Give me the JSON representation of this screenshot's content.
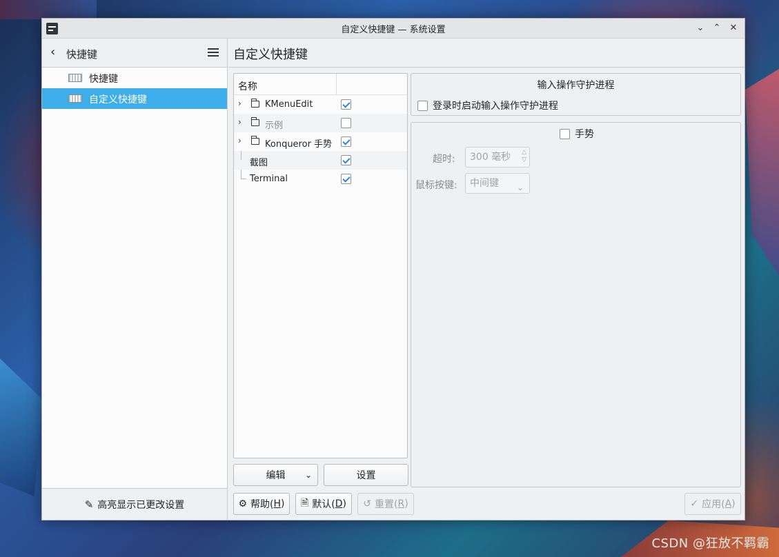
{
  "window": {
    "title": "自定义快捷键 — 系统设置",
    "controls": [
      "˅",
      "˄",
      "✕"
    ]
  },
  "sidebar": {
    "title": "快捷键",
    "items": [
      {
        "label": "快捷键",
        "icon": "keyboard-icon",
        "active": false
      },
      {
        "label": "自定义快捷键",
        "icon": "keyboard-icon",
        "active": true
      }
    ],
    "footer_label": "高亮显示已更改设置"
  },
  "main": {
    "title": "自定义快捷键",
    "tree": {
      "column_header": "名称",
      "rows": [
        {
          "label": "KMenuEdit",
          "type": "folder",
          "checked": true
        },
        {
          "label": "示例",
          "type": "folder",
          "checked": false
        },
        {
          "label": "Konqueror 手势",
          "type": "folder",
          "checked": true
        },
        {
          "label": "截图",
          "type": "item",
          "checked": true
        },
        {
          "label": "Terminal",
          "type": "item",
          "checked": true
        }
      ]
    },
    "edit_button": "编辑",
    "settings_button": "设置",
    "daemon_group": {
      "title": "输入操作守护进程",
      "checkbox_label": "登录时启动输入操作守护进程"
    },
    "gesture_group": {
      "checkbox_label": "手势",
      "timeout_label": "超时:",
      "timeout_value": "300 毫秒",
      "mouse_button_label": "鼠标按键:",
      "mouse_button_value": "中间键"
    }
  },
  "footer": {
    "help": {
      "text": "帮助(",
      "key": "H",
      "end": ")"
    },
    "defaults": {
      "text": "默认(",
      "key": "D",
      "end": ")"
    },
    "reset": {
      "text": "重置(",
      "key": "R",
      "end": ")"
    },
    "apply": {
      "text": "应用(",
      "key": "A",
      "end": ")"
    }
  },
  "watermark": "CSDN @狂放不羁霸"
}
